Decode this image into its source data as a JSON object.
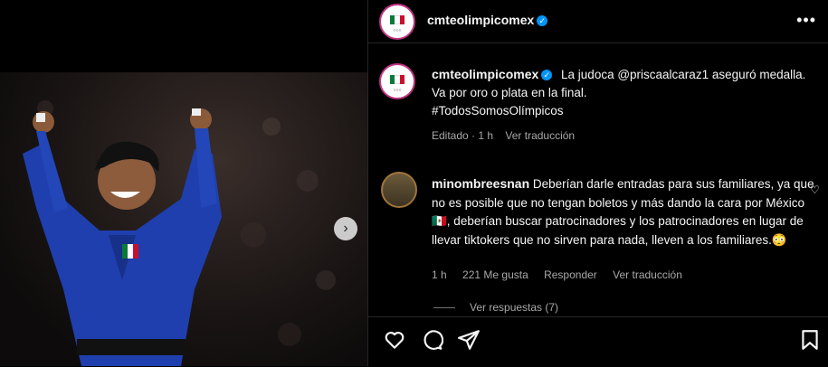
{
  "post": {
    "account": "cmteolimpicomex",
    "verified_icon": "verified-badge-icon",
    "more_icon": "more-options-icon"
  },
  "caption": {
    "username": "cmteolimpicomex",
    "line1": "La judoca @priscaalcaraz1 aseguró medalla.",
    "line2": "Va por oro o plata en la final.",
    "line3": "#TodosSomosOlímpicos",
    "time": "Editado · 1 h",
    "translate": "Ver traducción"
  },
  "comment": {
    "username": "minombreesnan",
    "text": "Deberían darle entradas para sus familiares, ya que no es posible que no tengan boletos y más dando la cara por México 🇲🇽, deberían buscar patrocinadores y los patrocinadores en lugar de llevar tiktokers que no sirven para nada, lleven a los familiares.😳",
    "time": "1 h",
    "likes": "221 Me gusta",
    "reply": "Responder",
    "translate": "Ver traducción",
    "view_replies": "Ver respuestas (7)"
  },
  "colors": {
    "accent": "#0095f6",
    "background": "#000000",
    "muted": "#a8a8a8",
    "text": "#f5f5f5"
  },
  "actions": [
    "heart-icon",
    "comment-icon",
    "share-icon",
    "bookmark-icon"
  ]
}
